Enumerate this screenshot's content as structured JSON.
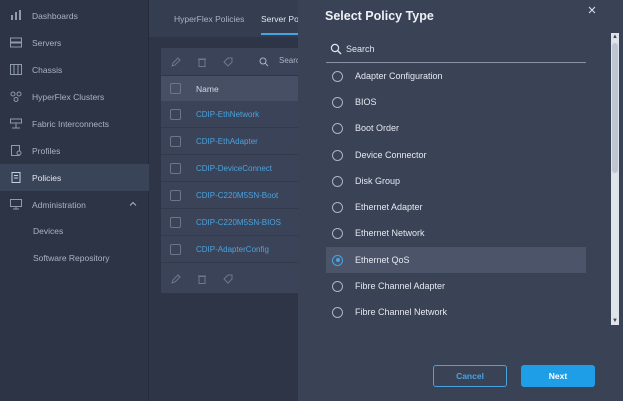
{
  "sidebar": {
    "items": [
      {
        "label": "Dashboards",
        "icon": "dashboard-icon"
      },
      {
        "label": "Servers",
        "icon": "server-icon"
      },
      {
        "label": "Chassis",
        "icon": "chassis-icon"
      },
      {
        "label": "HyperFlex Clusters",
        "icon": "cluster-icon"
      },
      {
        "label": "Fabric Interconnects",
        "icon": "fabric-icon"
      },
      {
        "label": "Profiles",
        "icon": "profile-icon"
      },
      {
        "label": "Policies",
        "icon": "policy-icon",
        "active": true
      },
      {
        "label": "Administration",
        "icon": "admin-icon"
      }
    ],
    "sub_items": [
      "Devices",
      "Software Repository"
    ]
  },
  "main": {
    "tabs": [
      "HyperFlex Policies",
      "Server Poli"
    ],
    "search_label": "Searc",
    "table": {
      "header": "Name",
      "rows": [
        "CDIP-EthNetwork",
        "CDIP-EthAdapter",
        "CDIP-DeviceConnect",
        "CDIP-C220M5SN-Boot",
        "CDIP-C220M5SN-BIOS",
        "CDIP-AdapterConfig"
      ]
    }
  },
  "modal": {
    "title": "Select Policy Type",
    "search_placeholder": "Search",
    "options": [
      "Adapter Configuration",
      "BIOS",
      "Boot Order",
      "Device Connector",
      "Disk Group",
      "Ethernet Adapter",
      "Ethernet Network",
      "Ethernet QoS",
      "Fibre Channel Adapter",
      "Fibre Channel Network"
    ],
    "selected": "Ethernet QoS",
    "cancel_label": "Cancel",
    "next_label": "Next"
  },
  "colors": {
    "accent": "#4aa3df",
    "primary_button": "#1f9ee8",
    "modal_bg": "#3a4256",
    "sidebar_bg": "#2c3445"
  }
}
